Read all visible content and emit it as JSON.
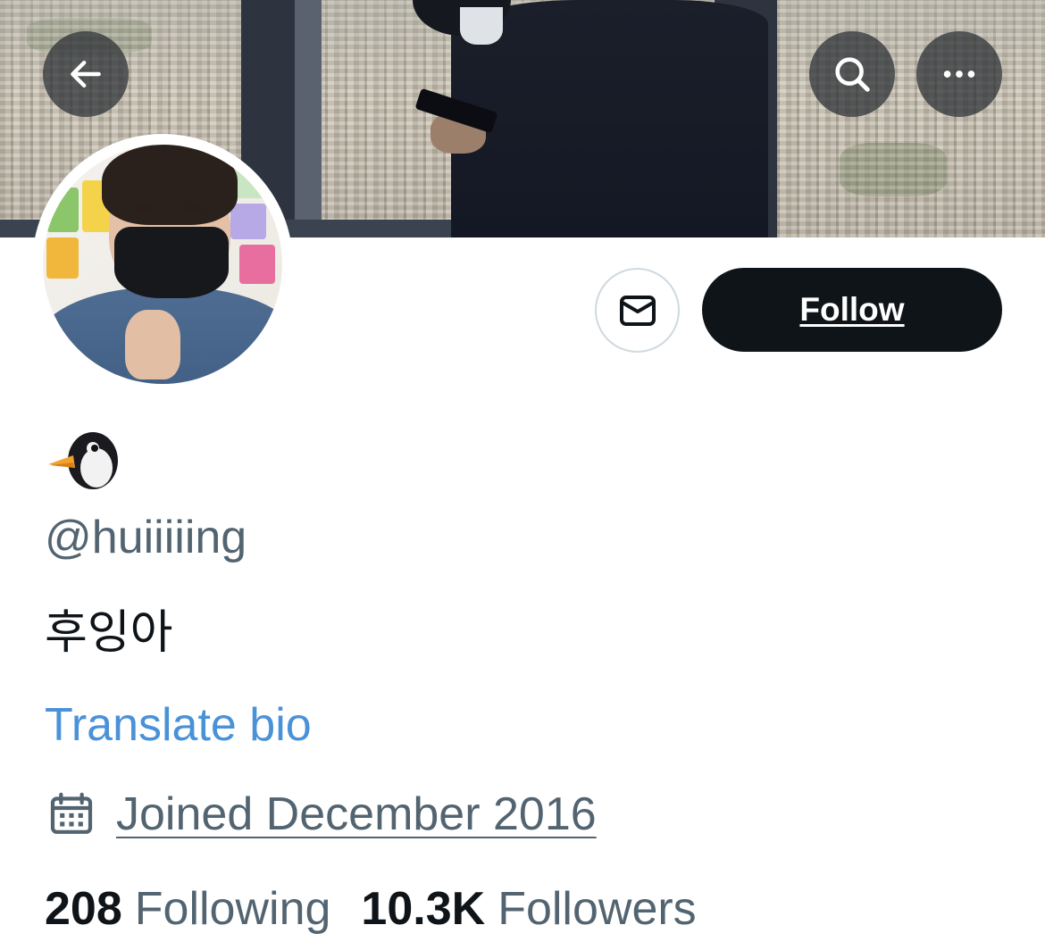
{
  "header": {
    "back_icon": "arrow-left-icon",
    "search_icon": "search-icon",
    "more_icon": "more-horizontal-icon"
  },
  "profile": {
    "display_name_emoji": "🐧",
    "handle": "@huiiiiing",
    "bio": "후잉아",
    "translate_bio_label": "Translate bio",
    "joined": "Joined December 2016",
    "joined_icon": "calendar-icon"
  },
  "actions": {
    "message_icon": "envelope-icon",
    "follow_label": "Follow"
  },
  "stats": {
    "following_count": "208",
    "following_label": "Following",
    "followers_count": "10.3K",
    "followers_label": "Followers"
  },
  "colors": {
    "follow_button_bg": "#0f1419",
    "link_blue": "#4a92d8",
    "secondary_text": "#536471",
    "primary_text": "#0f1419"
  }
}
